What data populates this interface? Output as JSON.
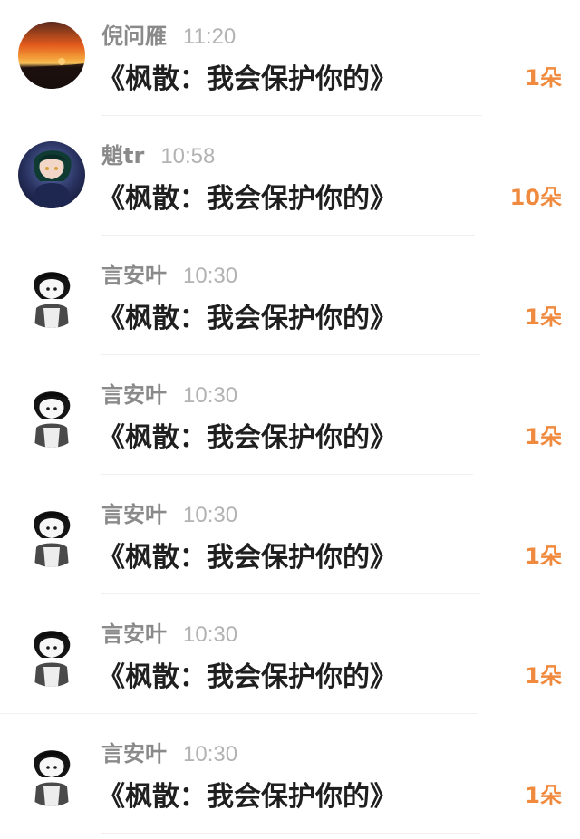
{
  "rows": [
    {
      "name": "倪问雁",
      "time": "11:20",
      "gift": "《枫散：我会保护你的》",
      "count": "1朵",
      "avatar_icon": "sunset-avatar-icon"
    },
    {
      "name": "魈tr",
      "time": "10:58",
      "gift": "《枫散：我会保护你的》",
      "count": "10朵",
      "avatar_icon": "anime-avatar-icon"
    },
    {
      "name": "言安叶",
      "time": "10:30",
      "gift": "《枫散：我会保护你的》",
      "count": "1朵",
      "avatar_icon": "sketch-avatar-icon"
    },
    {
      "name": "言安叶",
      "time": "10:30",
      "gift": "《枫散：我会保护你的》",
      "count": "1朵",
      "avatar_icon": "sketch-avatar-icon"
    },
    {
      "name": "言安叶",
      "time": "10:30",
      "gift": "《枫散：我会保护你的》",
      "count": "1朵",
      "avatar_icon": "sketch-avatar-icon"
    },
    {
      "name": "言安叶",
      "time": "10:30",
      "gift": "《枫散：我会保护你的》",
      "count": "1朵",
      "avatar_icon": "sketch-avatar-icon"
    },
    {
      "name": "言安叶",
      "time": "10:30",
      "gift": "《枫散：我会保护你的》",
      "count": "1朵",
      "avatar_icon": "sketch-avatar-icon"
    }
  ],
  "colors": {
    "name": "#8a8a8a",
    "time": "#b3b3b3",
    "title": "#1f1f1f",
    "count": "#f08a3e"
  }
}
